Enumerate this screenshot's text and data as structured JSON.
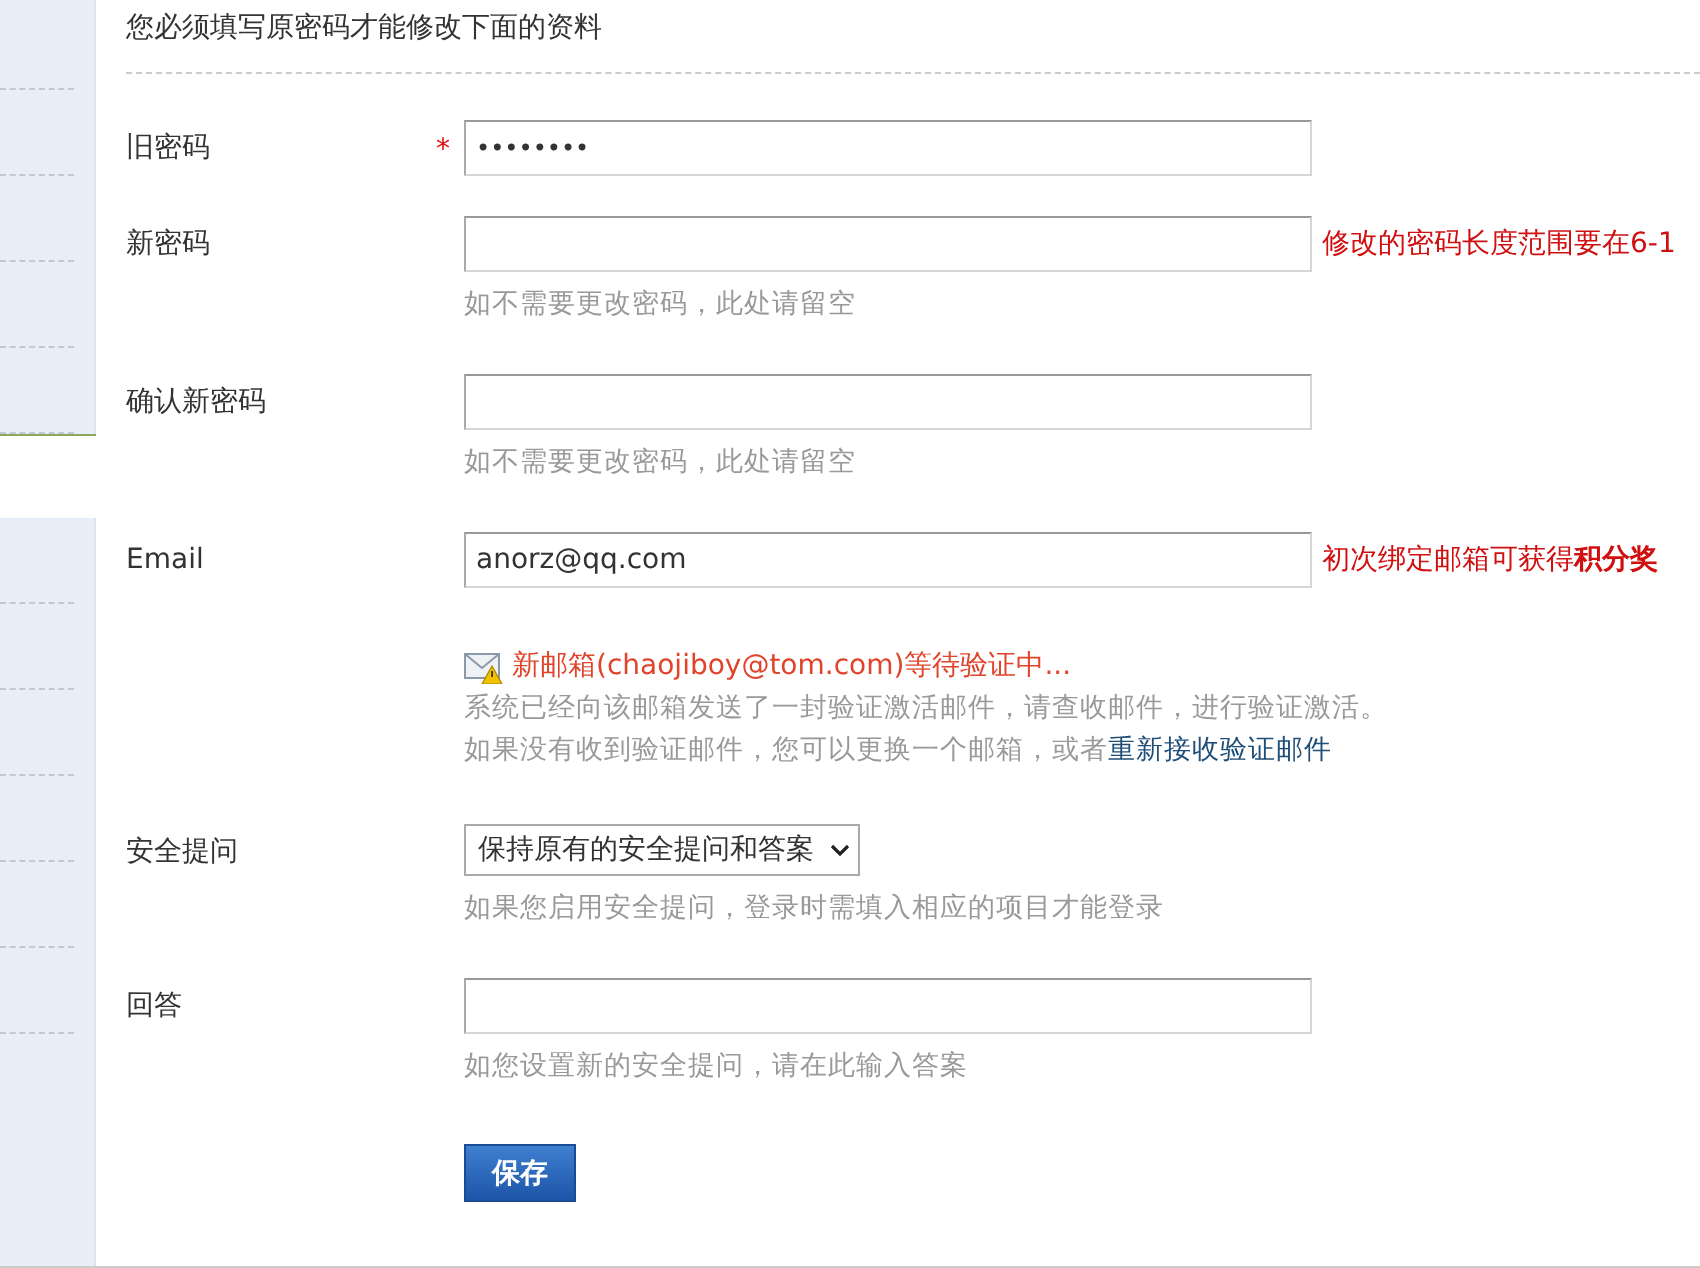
{
  "heading": "您必须填写原密码才能修改下面的资料",
  "fields": [
    {
      "kind": "password",
      "label": "旧密码",
      "required": true,
      "value": "••••••••"
    },
    {
      "kind": "password",
      "label": "新密码",
      "required": false,
      "note": "修改的密码长度范围要在6-1",
      "hint": "如不需要更改密码，此处请留空"
    },
    {
      "kind": "password",
      "label": "确认新密码",
      "required": false,
      "hint": "如不需要更改密码，此处请留空"
    },
    {
      "kind": "email",
      "label": "Email",
      "required": false,
      "value": "anorz@qq.com",
      "note": "初次绑定邮箱可获得**积分奖**",
      "pending": "新邮箱(chaojiboy@tom.com)等待验证中...",
      "sent": "系统已经向该邮箱发送了一封验证激活邮件，请查收邮件，进行验证激活。",
      "retry": "如果没有收到验证邮件，您可以更换一个邮箱，或者",
      "retry_link": "重新接收验证邮件"
    },
    {
      "kind": "select",
      "label": "安全提问",
      "required": false,
      "value": "保持原有的安全提问和答案",
      "hint": "如果您启用安全提问，登录时需填入相应的项目才能登录"
    },
    {
      "kind": "text",
      "label": "回答",
      "required": false,
      "hint": "如您设置新的安全提问，请在此输入答案"
    }
  ],
  "required_mark": "*",
  "save_button": "保存"
}
